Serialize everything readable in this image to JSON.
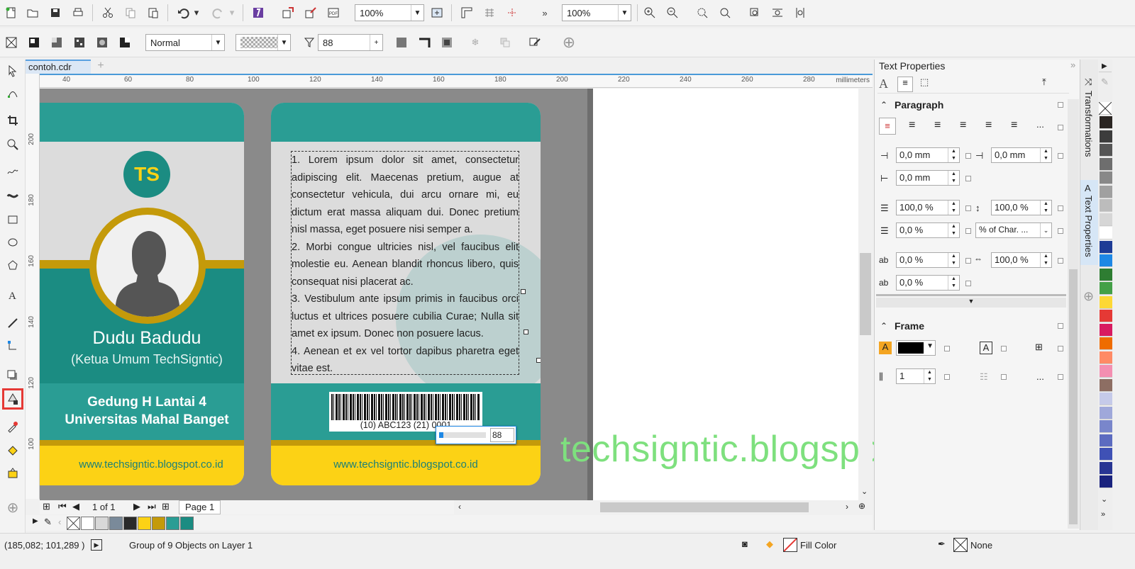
{
  "toolbar1": {
    "zoom1": "100%",
    "zoom2": "100%"
  },
  "toolbar2": {
    "merge_mode": "Normal",
    "transparency_value": "88"
  },
  "document": {
    "tab": "contoh.cdr"
  },
  "ruler": {
    "unit": "millimeters",
    "h_ticks": [
      "40",
      "60",
      "80",
      "100",
      "120",
      "140",
      "160",
      "180",
      "200",
      "220",
      "240",
      "260",
      "280"
    ],
    "v_ticks": [
      "200",
      "180",
      "160",
      "140",
      "120",
      "100"
    ]
  },
  "card_left": {
    "logo": "TS",
    "name": "Dudu Badudu",
    "role": "(Ketua Umum TechSigntic)",
    "addr1": "Gedung H Lantai 4",
    "addr2": "Universitas Mahal Banget",
    "url": "www.techsigntic.blogspot.co.id"
  },
  "card_right": {
    "rules": [
      "1. Lorem ipsum dolor sit amet, consectetur adipiscing elit. Maecenas pretium, augue at consectetur vehicula, dui arcu ornare mi, eu dictum erat massa aliquam dui. Donec pretium nisl massa, eget posuere nisi semper a.",
      "2. Morbi congue ultricies nisl, vel faucibus elit molestie eu. Aenean blandit rhoncus libero, quis consequat nisi placerat ac.",
      "3. Vestibulum ante ipsum primis in faucibus orci luctus et ultrices posuere cubilia Curae; Nulla sit amet ex ipsum. Donec non posuere lacus.",
      "4. Aenean et ex vel tortor dapibus pharetra eget vitae est."
    ],
    "barcode": "(10) ABC123 (21) 0001",
    "url": "www.techsigntic.blogspot.co.id",
    "slider_value": "88"
  },
  "pages": {
    "counter": "1 of 1",
    "page_tab": "Page 1"
  },
  "status": {
    "coords": "(185,082; 101,289 )",
    "selection": "Group of 9 Objects on Layer 1",
    "fill": "Fill Color",
    "outline": "None"
  },
  "panel": {
    "title": "Text Properties",
    "paragraph": "Paragraph",
    "frame": "Frame",
    "fields": {
      "left_indent": "0,0 mm",
      "first_indent": "0,0 mm",
      "right_indent": "0,0 mm",
      "para_before": "100,0 %",
      "line_spacing": "100,0 %",
      "para_after": "0,0 %",
      "spacing_unit": "% of Char. ...",
      "char_spacing": "0,0 %",
      "word_spacing": "100,0 %",
      "lang_spacing": "0,0 %",
      "columns": "1"
    }
  },
  "dock": {
    "tab1": "Transformations",
    "tab2": "Text Properties"
  },
  "watermark": "techsigntic.blogspot.co.id",
  "colors": {
    "teal": "#2a9d94",
    "yellow": "#fcd215",
    "gold": "#c49a0a",
    "highlight": "#e53935"
  },
  "doc_palette": [
    "#ffffff",
    "#d8d8d8",
    "#7a8a9a",
    "#2a2a2a",
    "#fcd215",
    "#c49a0a",
    "#2a9d94",
    "#1b8c82"
  ],
  "color_palette": [
    "#2a2522",
    "#3c3c3c",
    "#555555",
    "#6e6e6e",
    "#888888",
    "#a0a0a0",
    "#bcbcbc",
    "#d6d6d6",
    "#ffffff",
    "#1e3c96",
    "#1e88e5",
    "#2e7d32",
    "#43a047",
    "#fdd835",
    "#e53935",
    "#d81b60",
    "#ef6c00",
    "#ff8a65",
    "#f48fb1",
    "#8d6e63",
    "#c5cae9",
    "#9fa8da",
    "#7986cb",
    "#5c6bc0",
    "#3f51b5",
    "#283593",
    "#1a237e"
  ]
}
